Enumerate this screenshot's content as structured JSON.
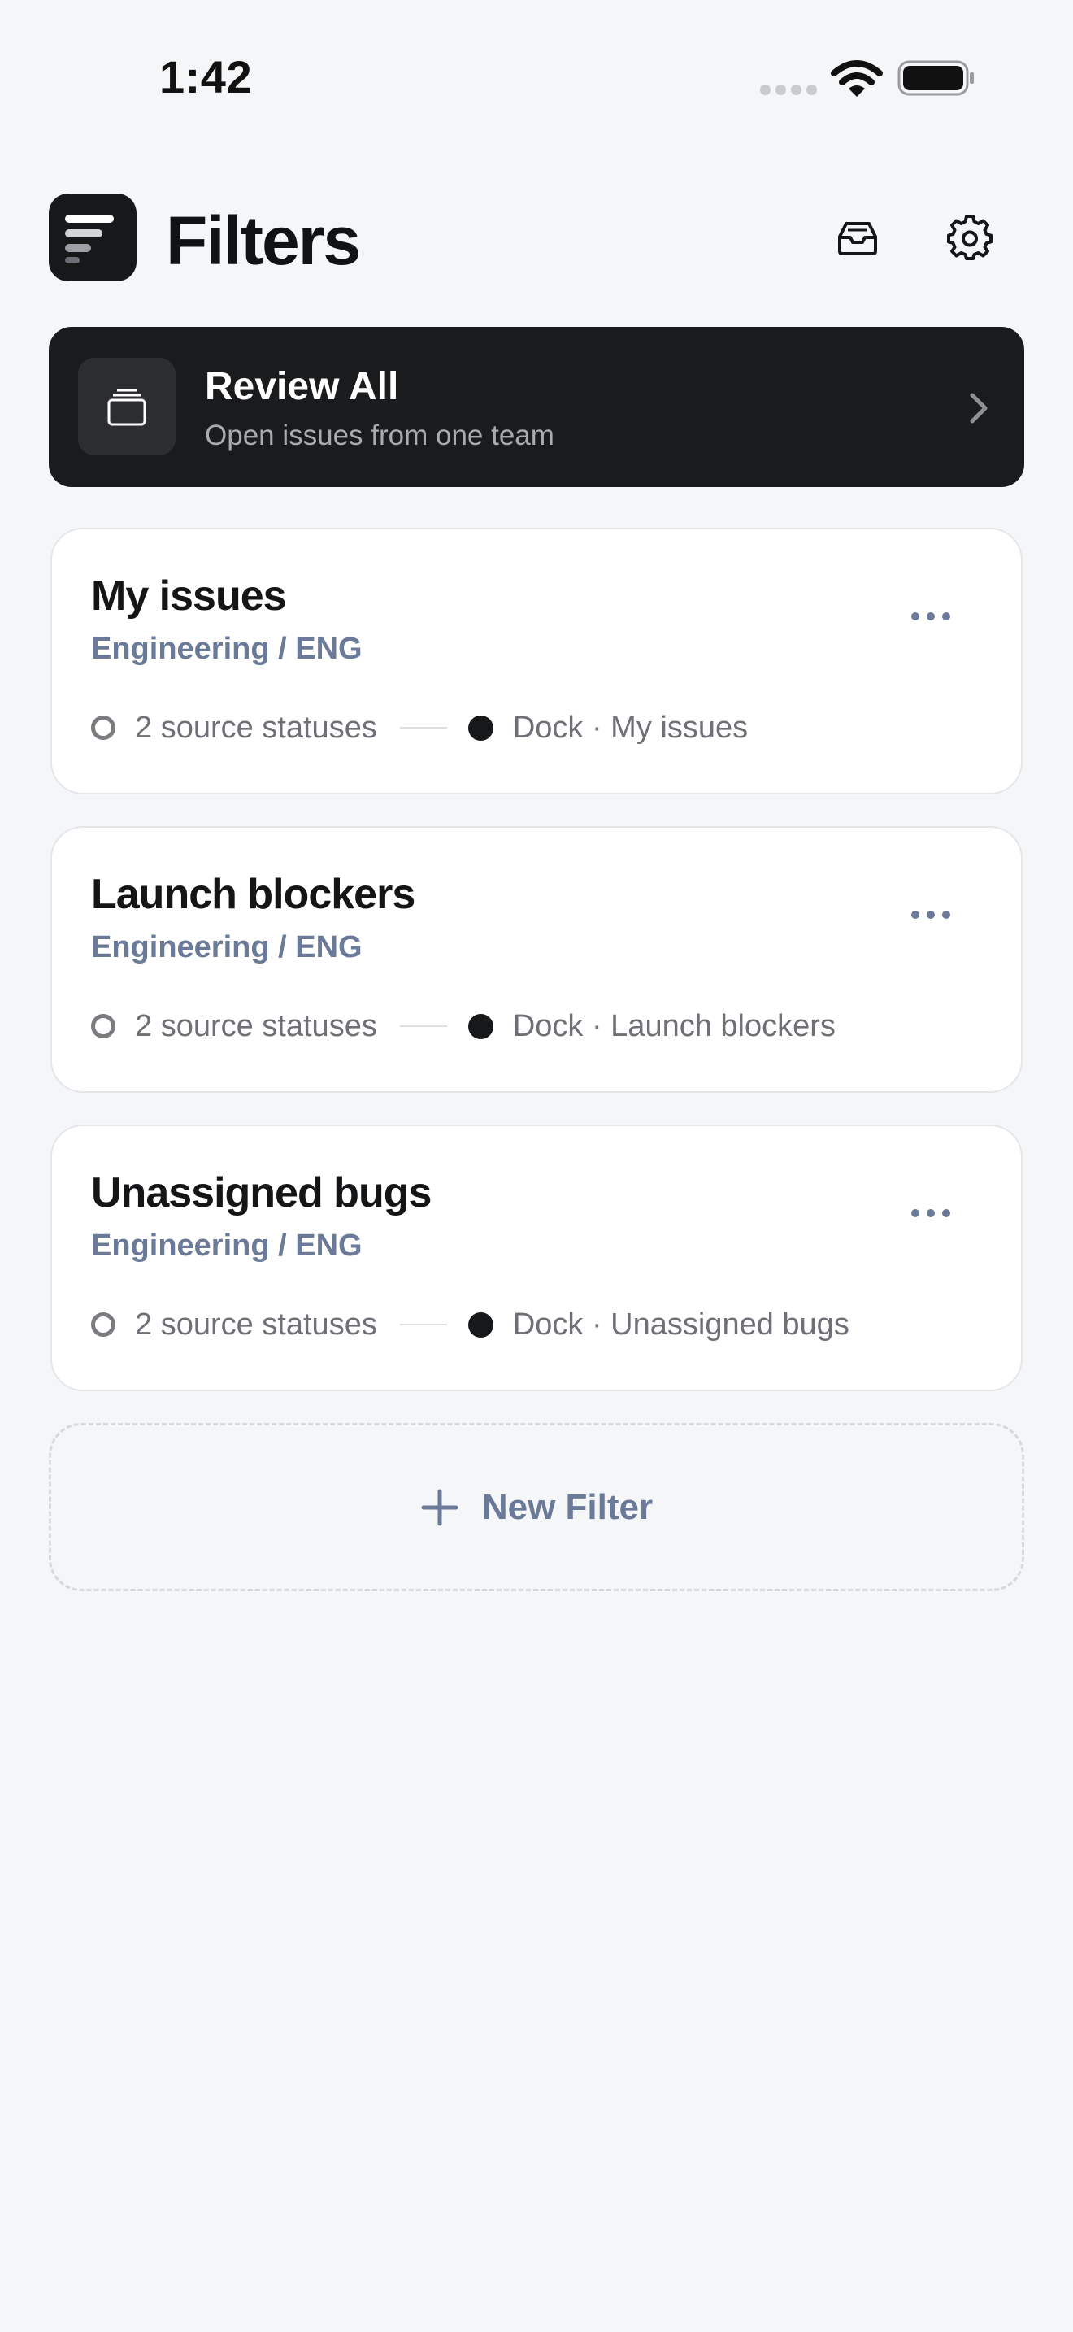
{
  "status_bar": {
    "time": "1:42",
    "icons": [
      "signal-dots-icon",
      "wifi-icon",
      "battery-icon"
    ]
  },
  "header": {
    "title": "Filters",
    "logo_icon": "app-logo-icon",
    "actions": [
      "inbox-icon",
      "gear-icon"
    ]
  },
  "review": {
    "title": "Review All",
    "subtitle": "Open issues from one team",
    "icon": "stack-icon"
  },
  "filters": [
    {
      "title": "My issues",
      "team": "Engineering / ENG",
      "source": "2 source statuses",
      "dest": "Dock · My issues"
    },
    {
      "title": "Launch blockers",
      "team": "Engineering / ENG",
      "source": "2 source statuses",
      "dest": "Dock · Launch blockers"
    },
    {
      "title": "Unassigned bugs",
      "team": "Engineering / ENG",
      "source": "2 source statuses",
      "dest": "Dock · Unassigned bugs"
    }
  ],
  "new_filter": {
    "label": "New Filter"
  },
  "colors": {
    "background": "#f5f6f8",
    "dark": "#1a1b1d",
    "accent_muted": "#6a7a98",
    "text_secondary": "#6e7075"
  }
}
